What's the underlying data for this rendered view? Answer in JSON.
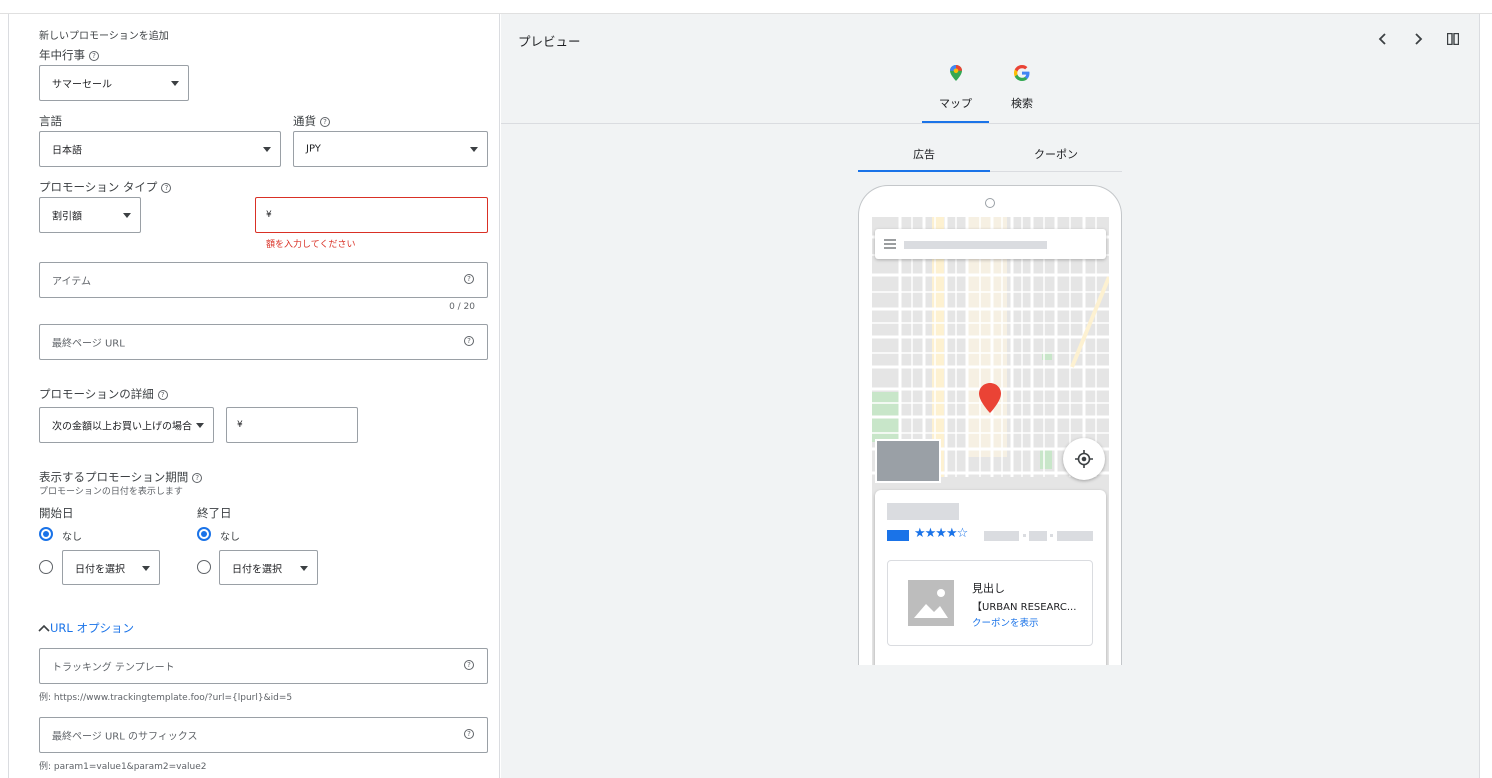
{
  "form": {
    "heading": "新しいプロモーションを追加",
    "occasion": {
      "label": "年中行事",
      "value": "サマーセール"
    },
    "language": {
      "label": "言語",
      "value": "日本語"
    },
    "currency": {
      "label": "通貨",
      "value": "JPY"
    },
    "promo_type": {
      "label": "プロモーション タイプ",
      "value": "割引額",
      "amount_prefix": "¥",
      "error": "額を入力してください"
    },
    "item": {
      "placeholder": "アイテム",
      "counter": "0 / 20"
    },
    "final_url": {
      "placeholder": "最終ページ URL"
    },
    "details": {
      "label": "プロモーションの詳細",
      "value": "次の金額以上お買い上げの場合",
      "amount_prefix": "¥"
    },
    "period": {
      "label": "表示するプロモーション期間",
      "sublabel": "プロモーションの日付を表示します",
      "start": {
        "label": "開始日",
        "none": "なし",
        "select": "日付を選択"
      },
      "end": {
        "label": "終了日",
        "none": "なし",
        "select": "日付を選択"
      }
    },
    "url_options": {
      "toggle": "URL オプション",
      "tracking": {
        "placeholder": "トラッキング テンプレート",
        "example": "例: https://www.trackingtemplate.foo/?url={lpurl}&id=5"
      },
      "suffix": {
        "placeholder": "最終ページ URL のサフィックス",
        "example": "例: param1=value1&param2=value2"
      }
    }
  },
  "preview": {
    "title": "プレビュー",
    "tabs": [
      {
        "label": "マップ",
        "icon": "maps-pin-icon"
      },
      {
        "label": "検索",
        "icon": "google-g-icon"
      }
    ],
    "subtabs": [
      "広告",
      "クーポン"
    ],
    "ad_card": {
      "headline": "見出し",
      "description": "【URBAN RESEARC...",
      "link": "クーポンを表示",
      "rating_stars": 4
    },
    "colors": {
      "accent": "#1a73e8",
      "error": "#d93025",
      "pin": "#ea4335"
    }
  }
}
